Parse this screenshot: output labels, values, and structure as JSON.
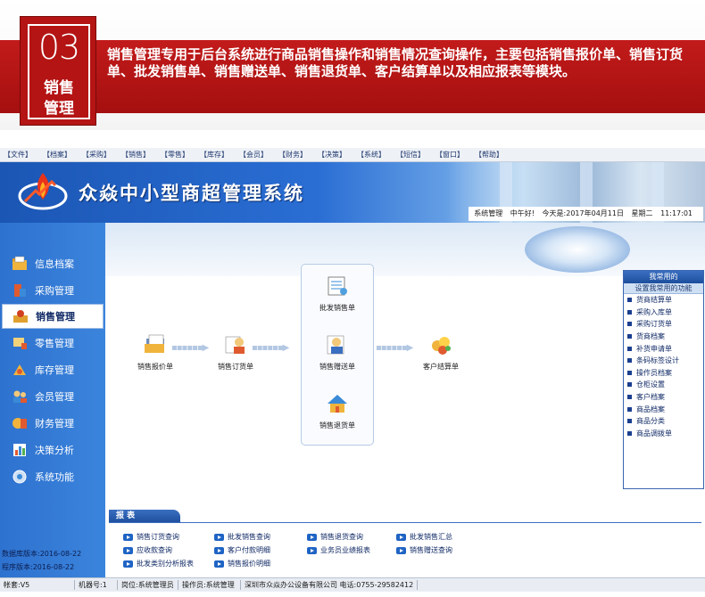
{
  "banner": {
    "badge_number": "03",
    "badge_line1": "销售",
    "badge_line2": "管理",
    "description": "销售管理专用于后台系统进行商品销售操作和销售情况查询操作，主要包括销售报价单、销售订货单、批发销售单、销售赠送单、销售退货单、客户结算单以及相应报表等模块。"
  },
  "menubar": [
    "【文件】",
    "【档案】",
    "【采购】",
    "【销售】",
    "【零售】",
    "【库存】",
    "【会员】",
    "【财务】",
    "【决策】",
    "【系统】",
    "【短信】",
    "【窗口】",
    "【帮助】"
  ],
  "header": {
    "title": "众焱中小型商超管理系统",
    "user": "系统管理",
    "greeting": "中午好!",
    "date": "今天是:2017年04月11日",
    "weekday": "星期二",
    "time": "11:17:01"
  },
  "sidebar": {
    "items": [
      {
        "label": "信息档案",
        "icon": "folder-icon"
      },
      {
        "label": "采购管理",
        "icon": "purchase-icon"
      },
      {
        "label": "销售管理",
        "icon": "sales-icon",
        "active": true
      },
      {
        "label": "零售管理",
        "icon": "retail-icon"
      },
      {
        "label": "库存管理",
        "icon": "inventory-icon"
      },
      {
        "label": "会员管理",
        "icon": "member-icon"
      },
      {
        "label": "财务管理",
        "icon": "finance-icon"
      },
      {
        "label": "决策分析",
        "icon": "chart-icon"
      },
      {
        "label": "系统功能",
        "icon": "system-icon"
      }
    ],
    "db_version": "数据库版本:2016-08-22",
    "app_version": "程序版本:2016-08-22"
  },
  "flow": {
    "quote": "销售报价单",
    "order": "销售订货单",
    "wholesale": "批发销售单",
    "gift": "销售赠送单",
    "return": "销售退货单",
    "settlement": "客户结算单"
  },
  "quick_panel": {
    "title": "我常用的",
    "subtitle": "设置我常用的功能",
    "items": [
      "货商结算单",
      "采购入库单",
      "采购订货单",
      "货商档案",
      "补货申请单",
      "条码标签设计",
      "操作员档案",
      "仓柜设置",
      "客户档案",
      "商品档案",
      "商品分类",
      "商品调拨单"
    ]
  },
  "reports": {
    "tab": "报 表",
    "links": [
      [
        "销售订货查询",
        "批发销售查询",
        "销售退货查询",
        "批发销售汇总"
      ],
      [
        "应收款查询",
        "客户付款明细",
        "业务员业绩报表",
        "销售赠送查询"
      ],
      [
        "批发类别分析报表",
        "销售报价明细"
      ]
    ]
  },
  "statusbar": {
    "account": "帐套:V5",
    "machine": "机器号:1",
    "position": "岗位:系统管理员",
    "operator": "操作员:系统管理",
    "company": "深圳市众焱办公设备有限公司 电话:0755-29582412"
  },
  "colors": {
    "banner_red": "#b41414",
    "app_blue": "#2a6ed4",
    "sidebar_blue": "#3b84dc",
    "link_blue": "#102a66"
  }
}
